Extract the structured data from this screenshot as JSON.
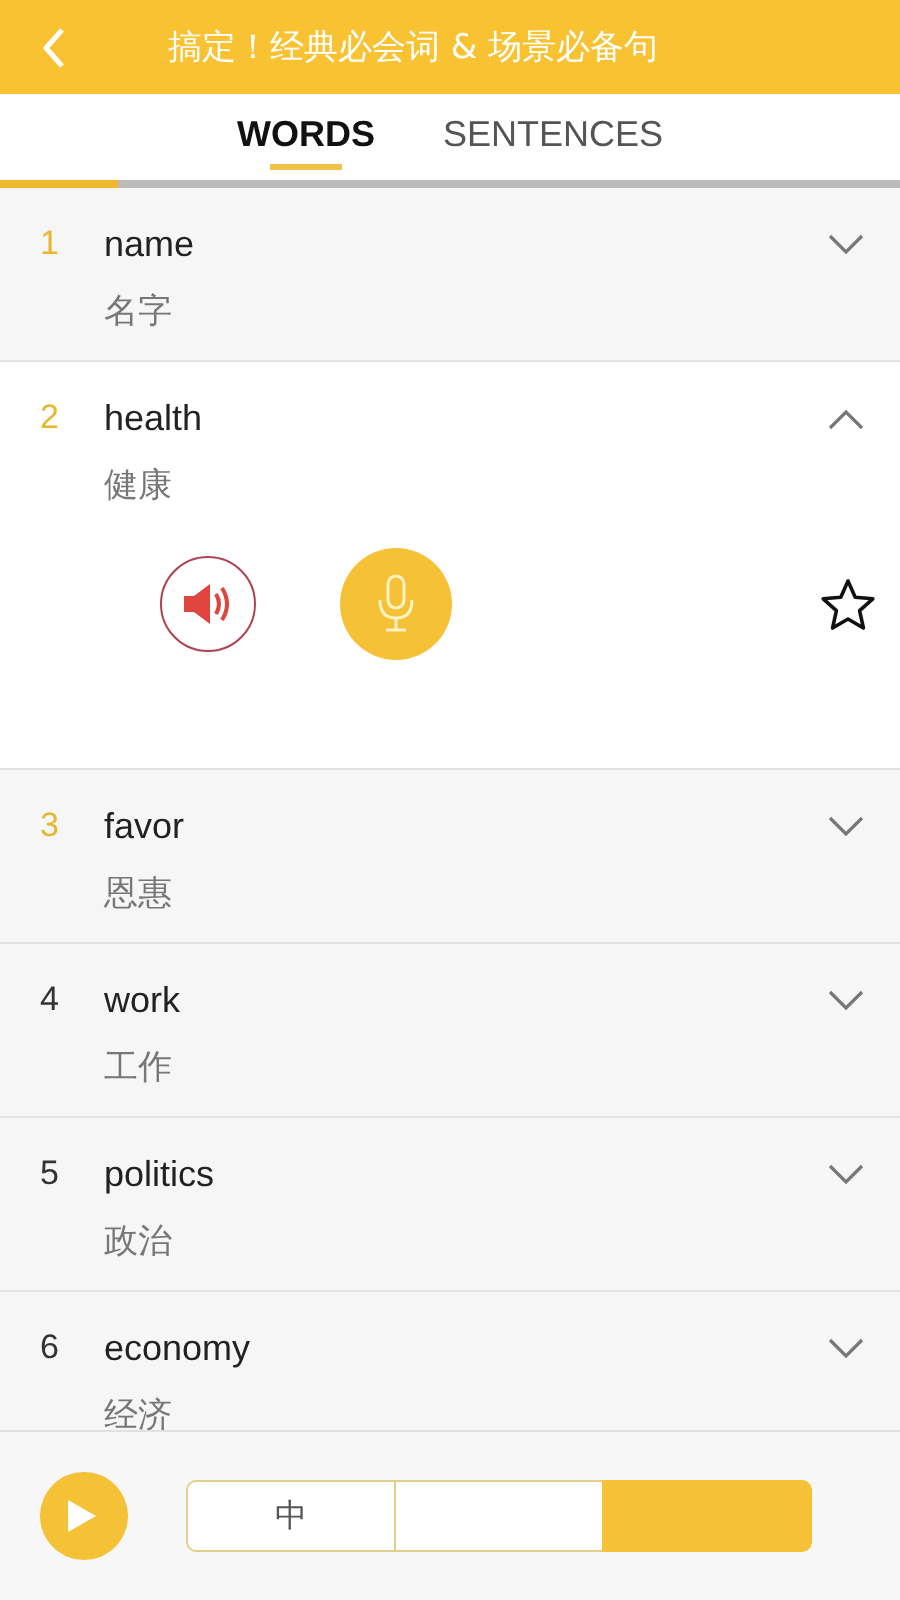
{
  "header": {
    "title": "搞定！经典必会词 & 场景必备句"
  },
  "tabs": [
    {
      "label": "WORDS",
      "selected": true
    },
    {
      "label": "SENTENCES",
      "selected": false
    }
  ],
  "progress": {
    "level": 0.13
  },
  "words": [
    {
      "number": "1",
      "word": "name",
      "meaning": "名字",
      "expanded": false,
      "color": "#e8b730"
    },
    {
      "number": "2",
      "word": "health",
      "meaning": "健康",
      "expanded": true,
      "color": "#e8b730"
    },
    {
      "number": "3",
      "word": "favor",
      "meaning": "恩惠",
      "expanded": false,
      "color": "#e8b730"
    },
    {
      "number": "4",
      "word": "work",
      "meaning": "工作",
      "expanded": false,
      "color": "#333333"
    },
    {
      "number": "5",
      "word": "politics",
      "meaning": "政治",
      "expanded": false,
      "color": "#333333"
    },
    {
      "number": "6",
      "word": "economy",
      "meaning": "经济",
      "expanded": false,
      "color": "#333333"
    }
  ],
  "bottom_bar": {
    "segments": [
      {
        "label": "中",
        "selected": false
      },
      {
        "selected": false
      },
      {
        "selected": true
      }
    ]
  }
}
